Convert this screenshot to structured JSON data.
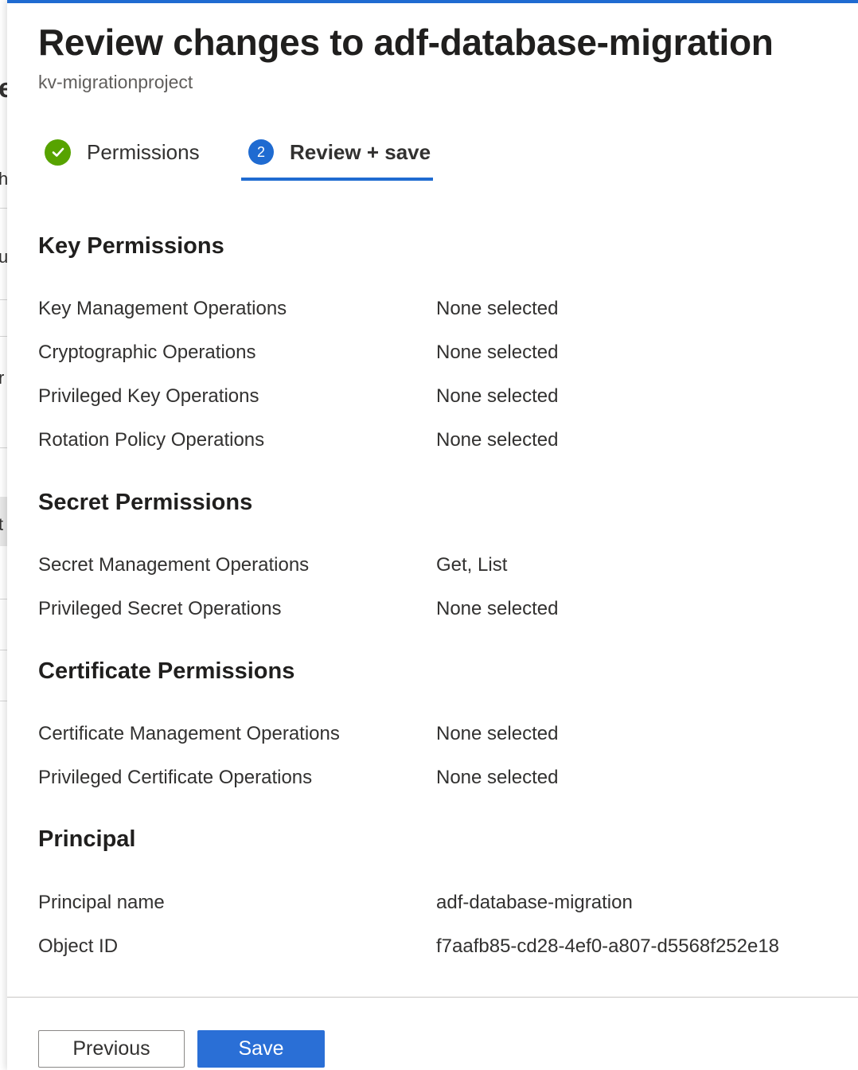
{
  "background": {
    "glyphs": [
      "e",
      "h",
      "u",
      "r",
      "t"
    ]
  },
  "header": {
    "title": "Review changes to adf-database-migration",
    "subtitle": "kv-migrationproject"
  },
  "steps": [
    {
      "label": "Permissions",
      "status": "completed",
      "icon": "check-circle-icon"
    },
    {
      "label": "Review + save",
      "number": "2",
      "status": "current"
    }
  ],
  "sections": {
    "key": {
      "title": "Key Permissions",
      "rows": [
        {
          "label": "Key Management Operations",
          "value": "None selected"
        },
        {
          "label": "Cryptographic Operations",
          "value": "None selected"
        },
        {
          "label": "Privileged Key Operations",
          "value": "None selected"
        },
        {
          "label": "Rotation Policy Operations",
          "value": "None selected"
        }
      ]
    },
    "secret": {
      "title": "Secret Permissions",
      "rows": [
        {
          "label": "Secret Management Operations",
          "value": "Get, List"
        },
        {
          "label": "Privileged Secret Operations",
          "value": "None selected"
        }
      ]
    },
    "certificate": {
      "title": "Certificate Permissions",
      "rows": [
        {
          "label": "Certificate Management Operations",
          "value": "None selected"
        },
        {
          "label": "Privileged Certificate Operations",
          "value": "None selected"
        }
      ]
    },
    "principal": {
      "title": "Principal",
      "rows": [
        {
          "label": "Principal name",
          "value": "adf-database-migration"
        },
        {
          "label": "Object ID",
          "value": "f7aafb85-cd28-4ef0-a807-d5568f252e18"
        }
      ]
    }
  },
  "footer": {
    "previous_label": "Previous",
    "save_label": "Save"
  },
  "colors": {
    "accent": "#1f6bd1",
    "success": "#57a300",
    "primary_button": "#2a6fd6"
  }
}
